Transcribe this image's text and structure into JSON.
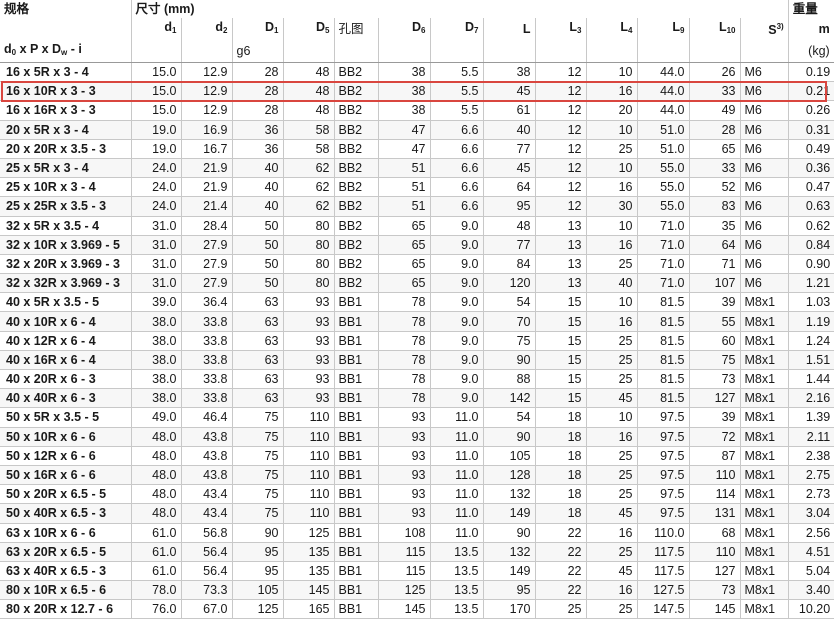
{
  "headers": {
    "spec_title": "规格",
    "spec_formula": "d₀ x P x Dw - i",
    "size_title": "尺寸 (mm)",
    "weight_title": "重量",
    "weight_symbol": "m",
    "weight_unit": "(kg)",
    "d1": "d1",
    "d2": "d2",
    "D1": "D1",
    "D1_tol": "g6",
    "D5": "D5",
    "hole": "孔图",
    "D6": "D6",
    "D7": "D7",
    "L": "L",
    "L3": "L3",
    "L4": "L4",
    "L9": "L9",
    "L10": "L10",
    "S": "S3)"
  },
  "highlight_color": "#d9463f",
  "rows": [
    [
      "16 x 5R x 3 - 4",
      "15.0",
      "12.9",
      "28",
      "48",
      "BB2",
      "38",
      "5.5",
      "38",
      "12",
      "10",
      "44.0",
      "26",
      "M6",
      "0.19"
    ],
    [
      "16 x 10R x 3 - 3",
      "15.0",
      "12.9",
      "28",
      "48",
      "BB2",
      "38",
      "5.5",
      "45",
      "12",
      "16",
      "44.0",
      "33",
      "M6",
      "0.21"
    ],
    [
      "16 x 16R x 3 - 3",
      "15.0",
      "12.9",
      "28",
      "48",
      "BB2",
      "38",
      "5.5",
      "61",
      "12",
      "20",
      "44.0",
      "49",
      "M6",
      "0.26"
    ],
    [
      "20 x 5R x 3 - 4",
      "19.0",
      "16.9",
      "36",
      "58",
      "BB2",
      "47",
      "6.6",
      "40",
      "12",
      "10",
      "51.0",
      "28",
      "M6",
      "0.31"
    ],
    [
      "20 x 20R x 3.5 - 3",
      "19.0",
      "16.7",
      "36",
      "58",
      "BB2",
      "47",
      "6.6",
      "77",
      "12",
      "25",
      "51.0",
      "65",
      "M6",
      "0.49"
    ],
    [
      "25 x 5R x 3 - 4",
      "24.0",
      "21.9",
      "40",
      "62",
      "BB2",
      "51",
      "6.6",
      "45",
      "12",
      "10",
      "55.0",
      "33",
      "M6",
      "0.36"
    ],
    [
      "25 x 10R x 3 - 4",
      "24.0",
      "21.9",
      "40",
      "62",
      "BB2",
      "51",
      "6.6",
      "64",
      "12",
      "16",
      "55.0",
      "52",
      "M6",
      "0.47"
    ],
    [
      "25 x 25R x 3.5 - 3",
      "24.0",
      "21.4",
      "40",
      "62",
      "BB2",
      "51",
      "6.6",
      "95",
      "12",
      "30",
      "55.0",
      "83",
      "M6",
      "0.63"
    ],
    [
      "32 x 5R x 3.5 - 4",
      "31.0",
      "28.4",
      "50",
      "80",
      "BB2",
      "65",
      "9.0",
      "48",
      "13",
      "10",
      "71.0",
      "35",
      "M6",
      "0.62"
    ],
    [
      "32 x 10R x 3.969 - 5",
      "31.0",
      "27.9",
      "50",
      "80",
      "BB2",
      "65",
      "9.0",
      "77",
      "13",
      "16",
      "71.0",
      "64",
      "M6",
      "0.84"
    ],
    [
      "32 x 20R x 3.969 - 3",
      "31.0",
      "27.9",
      "50",
      "80",
      "BB2",
      "65",
      "9.0",
      "84",
      "13",
      "25",
      "71.0",
      "71",
      "M6",
      "0.90"
    ],
    [
      "32 x 32R x 3.969 - 3",
      "31.0",
      "27.9",
      "50",
      "80",
      "BB2",
      "65",
      "9.0",
      "120",
      "13",
      "40",
      "71.0",
      "107",
      "M6",
      "1.21"
    ],
    [
      "40 x 5R x 3.5 - 5",
      "39.0",
      "36.4",
      "63",
      "93",
      "BB1",
      "78",
      "9.0",
      "54",
      "15",
      "10",
      "81.5",
      "39",
      "M8x1",
      "1.03"
    ],
    [
      "40 x 10R x 6 - 4",
      "38.0",
      "33.8",
      "63",
      "93",
      "BB1",
      "78",
      "9.0",
      "70",
      "15",
      "16",
      "81.5",
      "55",
      "M8x1",
      "1.19"
    ],
    [
      "40 x 12R x 6 - 4",
      "38.0",
      "33.8",
      "63",
      "93",
      "BB1",
      "78",
      "9.0",
      "75",
      "15",
      "25",
      "81.5",
      "60",
      "M8x1",
      "1.24"
    ],
    [
      "40 x 16R x 6 - 4",
      "38.0",
      "33.8",
      "63",
      "93",
      "BB1",
      "78",
      "9.0",
      "90",
      "15",
      "25",
      "81.5",
      "75",
      "M8x1",
      "1.51"
    ],
    [
      "40 x 20R x 6 - 3",
      "38.0",
      "33.8",
      "63",
      "93",
      "BB1",
      "78",
      "9.0",
      "88",
      "15",
      "25",
      "81.5",
      "73",
      "M8x1",
      "1.44"
    ],
    [
      "40 x 40R x 6 - 3",
      "38.0",
      "33.8",
      "63",
      "93",
      "BB1",
      "78",
      "9.0",
      "142",
      "15",
      "45",
      "81.5",
      "127",
      "M8x1",
      "2.16"
    ],
    [
      "50 x 5R x 3.5 - 5",
      "49.0",
      "46.4",
      "75",
      "110",
      "BB1",
      "93",
      "11.0",
      "54",
      "18",
      "10",
      "97.5",
      "39",
      "M8x1",
      "1.39"
    ],
    [
      "50 x 10R x 6 - 6",
      "48.0",
      "43.8",
      "75",
      "110",
      "BB1",
      "93",
      "11.0",
      "90",
      "18",
      "16",
      "97.5",
      "72",
      "M8x1",
      "2.11"
    ],
    [
      "50 x 12R x 6 - 6",
      "48.0",
      "43.8",
      "75",
      "110",
      "BB1",
      "93",
      "11.0",
      "105",
      "18",
      "25",
      "97.5",
      "87",
      "M8x1",
      "2.38"
    ],
    [
      "50 x 16R x 6 - 6",
      "48.0",
      "43.8",
      "75",
      "110",
      "BB1",
      "93",
      "11.0",
      "128",
      "18",
      "25",
      "97.5",
      "110",
      "M8x1",
      "2.75"
    ],
    [
      "50 x 20R x 6.5 - 5",
      "48.0",
      "43.4",
      "75",
      "110",
      "BB1",
      "93",
      "11.0",
      "132",
      "18",
      "25",
      "97.5",
      "114",
      "M8x1",
      "2.73"
    ],
    [
      "50 x 40R x 6.5 - 3",
      "48.0",
      "43.4",
      "75",
      "110",
      "BB1",
      "93",
      "11.0",
      "149",
      "18",
      "45",
      "97.5",
      "131",
      "M8x1",
      "3.04"
    ],
    [
      "63 x 10R x 6 - 6",
      "61.0",
      "56.8",
      "90",
      "125",
      "BB1",
      "108",
      "11.0",
      "90",
      "22",
      "16",
      "110.0",
      "68",
      "M8x1",
      "2.56"
    ],
    [
      "63 x 20R x 6.5 - 5",
      "61.0",
      "56.4",
      "95",
      "135",
      "BB1",
      "115",
      "13.5",
      "132",
      "22",
      "25",
      "117.5",
      "110",
      "M8x1",
      "4.51"
    ],
    [
      "63 x 40R x 6.5 - 3",
      "61.0",
      "56.4",
      "95",
      "135",
      "BB1",
      "115",
      "13.5",
      "149",
      "22",
      "45",
      "117.5",
      "127",
      "M8x1",
      "5.04"
    ],
    [
      "80 x 10R x 6.5 - 6",
      "78.0",
      "73.3",
      "105",
      "145",
      "BB1",
      "125",
      "13.5",
      "95",
      "22",
      "16",
      "127.5",
      "73",
      "M8x1",
      "3.40"
    ],
    [
      "80 x 20R x 12.7 - 6",
      "76.0",
      "67.0",
      "125",
      "165",
      "BB1",
      "145",
      "13.5",
      "170",
      "25",
      "25",
      "147.5",
      "145",
      "M8x1",
      "10.20"
    ]
  ]
}
